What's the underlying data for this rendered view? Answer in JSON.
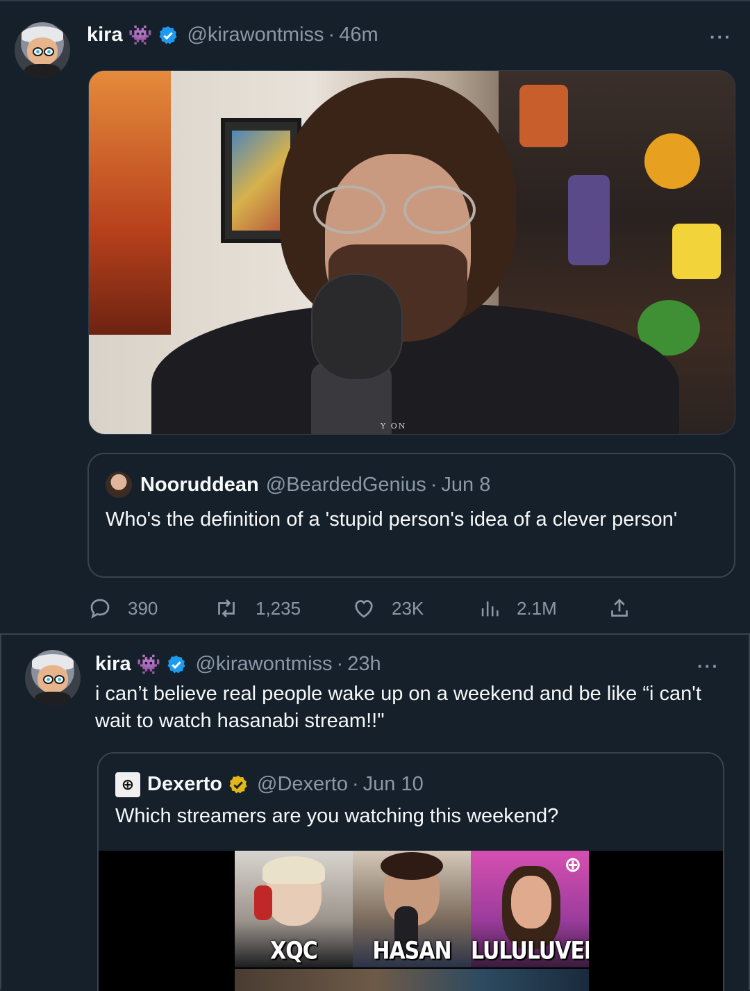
{
  "tweets": [
    {
      "author": {
        "name": "kira",
        "emoji": "👾",
        "handle": "@kirawontmiss",
        "time": "46m",
        "verified": true
      },
      "more": "···",
      "media_description": "streamer photo",
      "quote": {
        "name": "Nooruddean",
        "handle": "@BeardedGenius",
        "time": "Jun 8",
        "text": "Who's the definition of a 'stupid person's idea of a clever person'"
      },
      "mic_text": "Y ON",
      "actions": {
        "replies": "390",
        "retweets": "1,235",
        "likes": "23K",
        "views": "2.1M"
      }
    },
    {
      "author": {
        "name": "kira",
        "emoji": "👾",
        "handle": "@kirawontmiss",
        "time": "23h",
        "verified": true
      },
      "more": "···",
      "text": "i can’t believe real people wake up on a weekend and be like “i can't wait to watch hasanabi stream!!\"",
      "quote": {
        "name": "Dexerto",
        "handle": "@Dexerto",
        "time": "Jun 10",
        "logo": "⊕",
        "text": "Which streamers are you watching this weekend?",
        "collage_labels": [
          "XQC",
          "HASAN",
          "LULULUVELY"
        ]
      }
    }
  ],
  "colors": {
    "background": "#15202b",
    "text": "#f7f9f9",
    "muted": "#8b98a5",
    "verified_blue": "#1d9bf0",
    "verified_gold": "#e2b719",
    "border": "#38444d"
  }
}
